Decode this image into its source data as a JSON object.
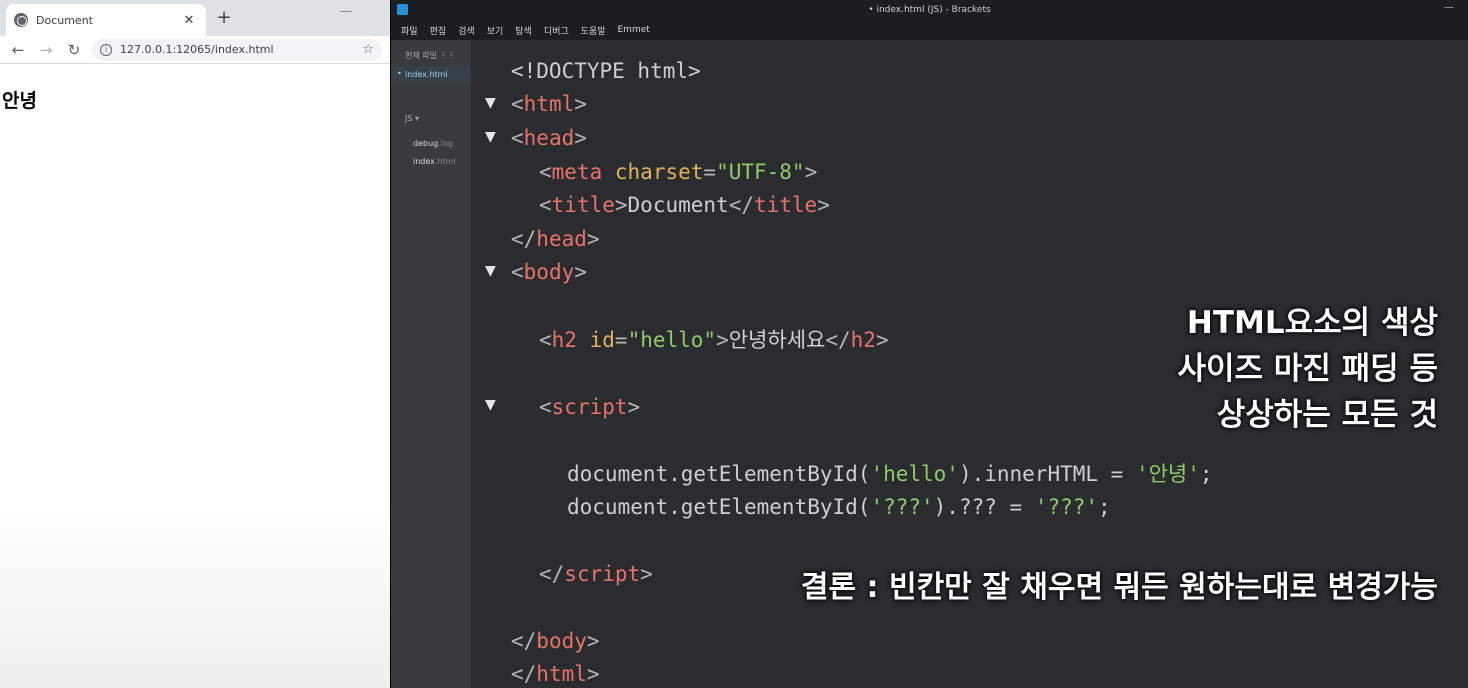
{
  "browser": {
    "tab_title": "Document",
    "tab_close": "✕",
    "new_tab": "+",
    "minimize": "—",
    "url": "127.0.0.1:12065/index.html",
    "page_heading": "안녕"
  },
  "editor": {
    "window_title": "• index.html (JS) - Brackets",
    "minimize": "—",
    "menu": [
      "파일",
      "편집",
      "검색",
      "보기",
      "탐색",
      "디버그",
      "도움말",
      "Emmet"
    ],
    "sidebar": {
      "working_files_header": "현재 파일 ⋮⋮",
      "active_file": "index.html",
      "project": "JS ▾",
      "files": [
        {
          "name": "debug",
          "ext": ".log"
        },
        {
          "name": "index",
          "ext": ".html"
        }
      ]
    },
    "code": {
      "doctype": "<!DOCTYPE html>",
      "html_open": "html",
      "head_open": "head",
      "meta": "meta",
      "charset_attr": "charset",
      "charset_val": "\"UTF-8\"",
      "title_tag": "title",
      "title_text": "Document",
      "head_close": "head",
      "body_open": "body",
      "h2_tag": "h2",
      "id_attr": "id",
      "id_val": "\"hello\"",
      "h2_text": "안녕하세요",
      "script_tag": "script",
      "js1_a": "document.getElementById(",
      "js1_arg": "'hello'",
      "js1_b": ").innerHTML = ",
      "js1_val": "'안녕'",
      "js1_end": ";",
      "js2_a": "document.getElementById(",
      "js2_arg": "'???'",
      "js2_b": ").??? = ",
      "js2_val": "'???'",
      "js2_end": ";",
      "script_close": "script",
      "body_close": "body",
      "html_close": "html"
    }
  },
  "overlays": {
    "note_line1": "HTML요소의 색상",
    "note_line2": "사이즈 마진 패딩 등",
    "note_line3": "상상하는 모든 것",
    "conclusion": "결론 : 빈칸만 잘 채우면 뭐든 원하는대로 변경가능"
  }
}
